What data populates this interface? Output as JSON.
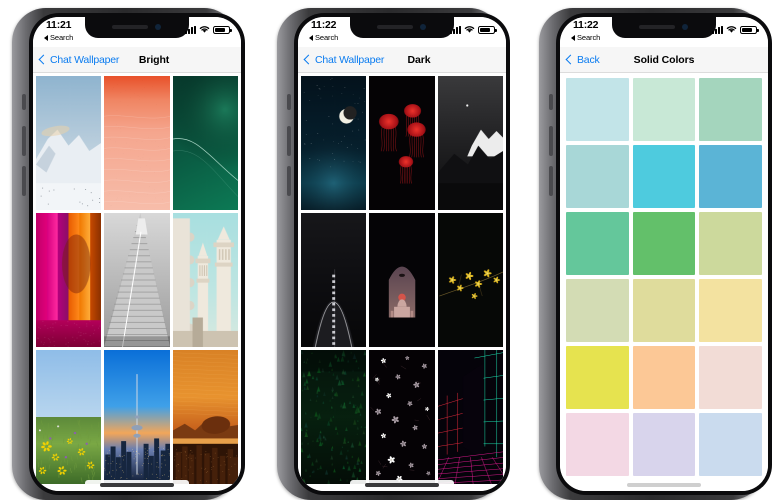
{
  "page": {
    "title": "iOS Chat Wallpaper picker — three iPhone screens",
    "background": "#ffffff"
  },
  "phones": [
    {
      "id": "phone-bright",
      "status": {
        "time": "11:21",
        "back_label": "Search",
        "signal_icon": "cellular-bars-icon",
        "wifi_icon": "wifi-icon",
        "battery_icon": "battery-icon"
      },
      "nav": {
        "back_label": "Chat Wallpaper",
        "back_icon": "chevron-left-icon",
        "title": "Bright",
        "accent": "#0b7cf0"
      },
      "grid_kind": "wallpapers",
      "wallpapers": [
        {
          "name": "snowy-mountain-ridge",
          "style": "snow"
        },
        {
          "name": "coral-pink-marble",
          "style": "coral"
        },
        {
          "name": "emerald-green-abstract",
          "style": "emerald"
        },
        {
          "name": "magenta-orange-curtains",
          "style": "curtains"
        },
        {
          "name": "grayscale-step-pyramid",
          "style": "pyramid"
        },
        {
          "name": "white-mosque-minarets",
          "style": "mosque"
        },
        {
          "name": "yellow-wildflower-meadow",
          "style": "meadow"
        },
        {
          "name": "kuwait-tower-city-skyline",
          "style": "tower"
        },
        {
          "name": "rio-sugarloaf-sunset",
          "style": "rio"
        }
      ]
    },
    {
      "id": "phone-dark",
      "status": {
        "time": "11:22",
        "back_label": "Search",
        "signal_icon": "cellular-bars-icon",
        "wifi_icon": "wifi-icon",
        "battery_icon": "battery-icon"
      },
      "nav": {
        "back_label": "Chat Wallpaper",
        "back_icon": "chevron-left-icon",
        "title": "Dark",
        "accent": "#0b7cf0"
      },
      "grid_kind": "wallpapers",
      "wallpapers": [
        {
          "name": "crescent-moon-night-sky",
          "style": "moon"
        },
        {
          "name": "red-jellyfish-on-black",
          "style": "jelly"
        },
        {
          "name": "moonlit-snow-peak",
          "style": "peak"
        },
        {
          "name": "dark-arch-monument",
          "style": "arch"
        },
        {
          "name": "taj-mahal-night-window",
          "style": "taj"
        },
        {
          "name": "yellow-blossom-branch",
          "style": "branch"
        },
        {
          "name": "dark-pine-forest",
          "style": "forest"
        },
        {
          "name": "white-blossoms-on-black",
          "style": "blossom"
        },
        {
          "name": "neon-grid-room",
          "style": "neon"
        }
      ]
    },
    {
      "id": "phone-solid",
      "status": {
        "time": "11:22",
        "back_label": "Search",
        "signal_icon": "cellular-bars-icon",
        "wifi_icon": "wifi-icon",
        "battery_icon": "battery-icon"
      },
      "nav": {
        "back_label": "Back",
        "back_icon": "chevron-left-icon",
        "title": "Solid Colors",
        "accent": "#0b7cf0"
      },
      "grid_kind": "solid_colors",
      "solid_colors": [
        {
          "name": "pale-aqua",
          "hex": "#c2e4e8"
        },
        {
          "name": "pale-mint",
          "hex": "#c8e8d6"
        },
        {
          "name": "soft-seafoam",
          "hex": "#a4d5bd"
        },
        {
          "name": "muted-turquoise",
          "hex": "#a8d7d7"
        },
        {
          "name": "bright-cyan",
          "hex": "#4ecbde"
        },
        {
          "name": "sky-blue",
          "hex": "#5bb4d6"
        },
        {
          "name": "jade-green",
          "hex": "#64c79b"
        },
        {
          "name": "grass-green",
          "hex": "#63c06a"
        },
        {
          "name": "pale-olive",
          "hex": "#ccd99c"
        },
        {
          "name": "sage-cream",
          "hex": "#d3dcb4"
        },
        {
          "name": "khaki-yellow",
          "hex": "#dfdc9c"
        },
        {
          "name": "butter-yellow",
          "hex": "#f3e2a0"
        },
        {
          "name": "lemon-yellow",
          "hex": "#e6e34f"
        },
        {
          "name": "peach-orange",
          "hex": "#fcc896"
        },
        {
          "name": "blush-pink",
          "hex": "#f2dcd6"
        },
        {
          "name": "baby-pink",
          "hex": "#f3d8e4"
        },
        {
          "name": "lavender",
          "hex": "#d8d4ec"
        },
        {
          "name": "powder-blue",
          "hex": "#cadbee"
        }
      ]
    }
  ]
}
